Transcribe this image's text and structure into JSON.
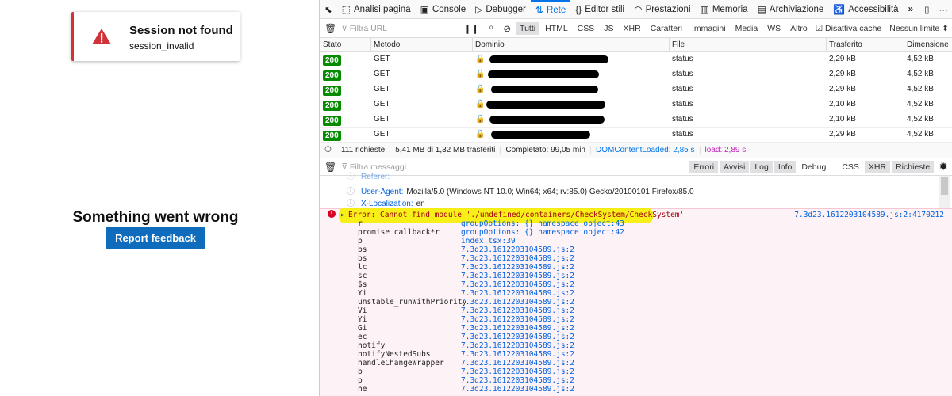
{
  "left": {
    "toast_title": "Session not found",
    "toast_sub": "session_invalid",
    "error_title": "Something went wrong",
    "feedback_button": "Report feedback"
  },
  "devtools": {
    "tabs": [
      {
        "icon": "⬚",
        "label": "Analisi pagina"
      },
      {
        "icon": "▣",
        "label": "Console"
      },
      {
        "icon": "▷",
        "label": "Debugger"
      },
      {
        "icon": "⇅",
        "label": "Rete"
      },
      {
        "icon": "{}",
        "label": "Editor stili"
      },
      {
        "icon": "◠",
        "label": "Prestazioni"
      },
      {
        "icon": "▥",
        "label": "Memoria"
      },
      {
        "icon": "▤",
        "label": "Archiviazione"
      },
      {
        "icon": "♿",
        "label": "Accessibilità"
      }
    ],
    "network_filter_placeholder": "Filtra URL",
    "type_filters": [
      "Tutti",
      "HTML",
      "CSS",
      "JS",
      "XHR",
      "Caratteri",
      "Immagini",
      "Media",
      "WS",
      "Altro"
    ],
    "disable_cache": "Disattiva cache",
    "throttle": "Nessun limite",
    "columns": [
      "Stato",
      "Metodo",
      "Dominio",
      "File",
      "Trasferito",
      "Dimensione"
    ],
    "rows": [
      {
        "status": "200",
        "method": "GET",
        "file": "status",
        "transferred": "2,29 kB",
        "size": "4,52 kB"
      },
      {
        "status": "200",
        "method": "GET",
        "file": "status",
        "transferred": "2,29 kB",
        "size": "4,52 kB"
      },
      {
        "status": "200",
        "method": "GET",
        "file": "status",
        "transferred": "2,29 kB",
        "size": "4,52 kB"
      },
      {
        "status": "200",
        "method": "GET",
        "file": "status",
        "transferred": "2,10 kB",
        "size": "4,52 kB"
      },
      {
        "status": "200",
        "method": "GET",
        "file": "status",
        "transferred": "2,10 kB",
        "size": "4,52 kB"
      },
      {
        "status": "200",
        "method": "GET",
        "file": "status",
        "transferred": "2,29 kB",
        "size": "4,52 kB"
      }
    ],
    "summary": {
      "requests": "111 richieste",
      "transferred": "5,41 MB di 1,32 MB trasferiti",
      "finished": "Completato: 99,05 min",
      "dcl": "DOMContentLoaded: 2,85 s",
      "load": "load: 2,89 s"
    },
    "console_filter_placeholder": "Filtra messaggi",
    "levels": [
      "Errori",
      "Avvisi",
      "Log",
      "Info",
      "Debug"
    ],
    "categories": [
      "CSS",
      "XHR",
      "Richieste"
    ],
    "headers": [
      {
        "name": "Referer:",
        "value": ""
      },
      {
        "name": "User-Agent:",
        "value": "Mozilla/5.0 (Windows NT 10.0; Win64; x64; rv:85.0) Gecko/20100101 Firefox/85.0"
      },
      {
        "name": "X-Localization:",
        "value": "en"
      }
    ],
    "error": {
      "message": "Error: Cannot find module './undefined/containers/CheckSystem/CheckSystem'",
      "location": "7.3d23.1612203104589.js:2:4170212"
    },
    "frames": [
      [
        "r",
        "groupOptions: {} namespace object:43"
      ],
      [
        "promise callback*r",
        "groupOptions: {} namespace object:42"
      ],
      [
        "p",
        "index.tsx:39"
      ],
      [
        "bs",
        "7.3d23.1612203104589.js:2"
      ],
      [
        "bs",
        "7.3d23.1612203104589.js:2"
      ],
      [
        "lc",
        "7.3d23.1612203104589.js:2"
      ],
      [
        "sc",
        "7.3d23.1612203104589.js:2"
      ],
      [
        "$s",
        "7.3d23.1612203104589.js:2"
      ],
      [
        "Yi",
        "7.3d23.1612203104589.js:2"
      ],
      [
        "unstable_runWithPriority",
        "7.3d23.1612203104589.js:2"
      ],
      [
        "Vi",
        "7.3d23.1612203104589.js:2"
      ],
      [
        "Yi",
        "7.3d23.1612203104589.js:2"
      ],
      [
        "Gi",
        "7.3d23.1612203104589.js:2"
      ],
      [
        "ec",
        "7.3d23.1612203104589.js:2"
      ],
      [
        "notify",
        "7.3d23.1612203104589.js:2"
      ],
      [
        "notifyNestedSubs",
        "7.3d23.1612203104589.js:2"
      ],
      [
        "handleChangeWrapper",
        "7.3d23.1612203104589.js:2"
      ],
      [
        "b",
        "7.3d23.1612203104589.js:2"
      ],
      [
        "p",
        "7.3d23.1612203104589.js:2"
      ],
      [
        "ne",
        "7.3d23.1612203104589.js:2"
      ]
    ]
  }
}
